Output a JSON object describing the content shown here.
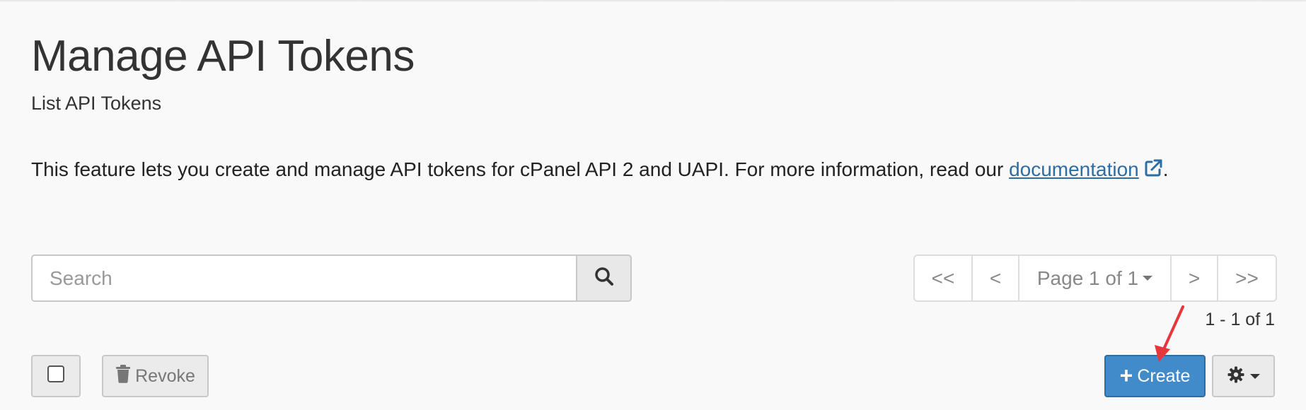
{
  "page": {
    "title": "Manage API Tokens",
    "subtitle": "List API Tokens",
    "description_text": "This feature lets you create and manage API tokens for cPanel API 2 and UAPI. For more information, read our ",
    "doc_link_label": "documentation",
    "description_end": "."
  },
  "search": {
    "placeholder": "Search",
    "icon": "search-icon"
  },
  "pagination": {
    "first": "<<",
    "prev": "<",
    "page_label": "Page 1 of 1",
    "next": ">",
    "last": ">>",
    "record_count": "1 - 1 of 1"
  },
  "toolbar": {
    "revoke_label": "Revoke",
    "revoke_icon": "trash-icon",
    "create_label": "Create",
    "create_icon": "plus-icon",
    "settings_icon": "gear-icon"
  },
  "colors": {
    "primary": "#428bca",
    "link": "#2e6da4",
    "annotation_arrow": "#e8373c"
  }
}
